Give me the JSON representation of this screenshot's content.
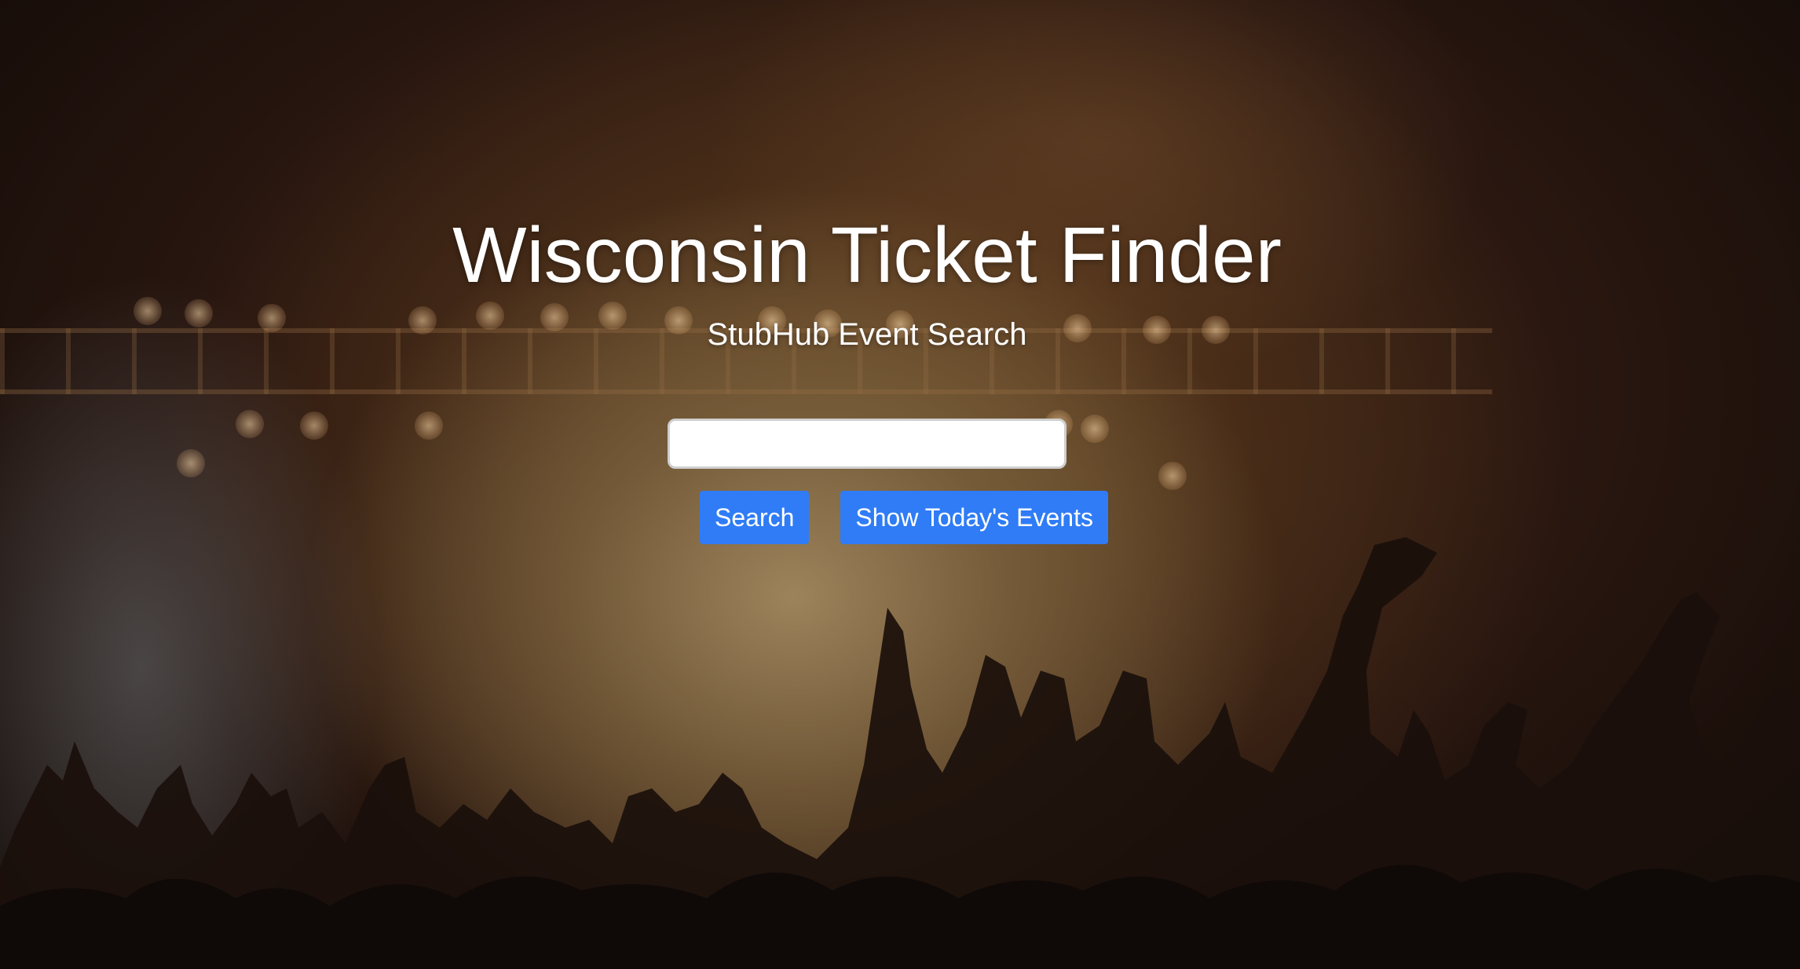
{
  "hero": {
    "title": "Wisconsin Ticket Finder",
    "subtitle": "StubHub Event Search"
  },
  "search": {
    "value": "",
    "placeholder": ""
  },
  "buttons": {
    "search_label": "Search",
    "today_label": "Show Today's Events"
  },
  "colors": {
    "button_bg": "#2f7cf6",
    "text": "#ffffff"
  }
}
